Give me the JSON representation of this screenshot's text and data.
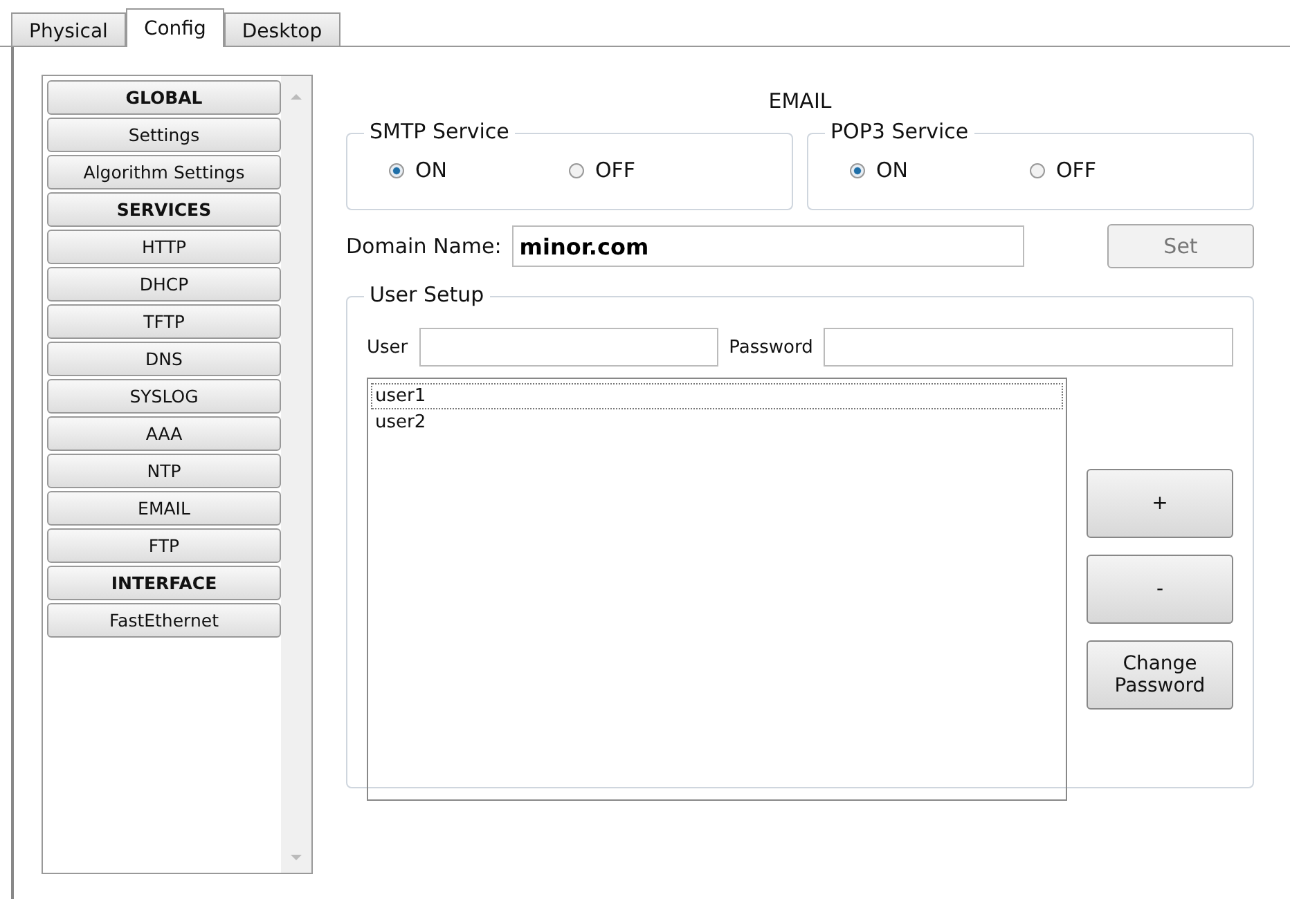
{
  "tabs": [
    {
      "label": "Physical",
      "selected": false
    },
    {
      "label": "Config",
      "selected": true
    },
    {
      "label": "Desktop",
      "selected": false
    }
  ],
  "sidebar": {
    "items": [
      {
        "label": "GLOBAL",
        "kind": "header"
      },
      {
        "label": "Settings",
        "kind": "item"
      },
      {
        "label": "Algorithm Settings",
        "kind": "item"
      },
      {
        "label": "SERVICES",
        "kind": "header"
      },
      {
        "label": "HTTP",
        "kind": "item"
      },
      {
        "label": "DHCP",
        "kind": "item"
      },
      {
        "label": "TFTP",
        "kind": "item"
      },
      {
        "label": "DNS",
        "kind": "item"
      },
      {
        "label": "SYSLOG",
        "kind": "item"
      },
      {
        "label": "AAA",
        "kind": "item"
      },
      {
        "label": "NTP",
        "kind": "item"
      },
      {
        "label": "EMAIL",
        "kind": "item"
      },
      {
        "label": "FTP",
        "kind": "item"
      },
      {
        "label": "INTERFACE",
        "kind": "header"
      },
      {
        "label": "FastEthernet",
        "kind": "item"
      }
    ]
  },
  "title": "EMAIL",
  "services": [
    {
      "title": "SMTP Service",
      "options": [
        {
          "label": "ON",
          "selected": true
        },
        {
          "label": "OFF",
          "selected": false
        }
      ]
    },
    {
      "title": "POP3 Service",
      "options": [
        {
          "label": "ON",
          "selected": true
        },
        {
          "label": "OFF",
          "selected": false
        }
      ]
    }
  ],
  "domain": {
    "label": "Domain Name:",
    "value": "minor.com",
    "button": {
      "label": "Set",
      "disabled": true
    }
  },
  "user_setup": {
    "title": "User Setup",
    "user_label": "User",
    "password_label": "Password",
    "users": [
      {
        "name": "user1",
        "selected": true
      },
      {
        "name": "user2",
        "selected": false
      }
    ],
    "buttons": [
      "+",
      "-",
      "Change Password"
    ]
  }
}
